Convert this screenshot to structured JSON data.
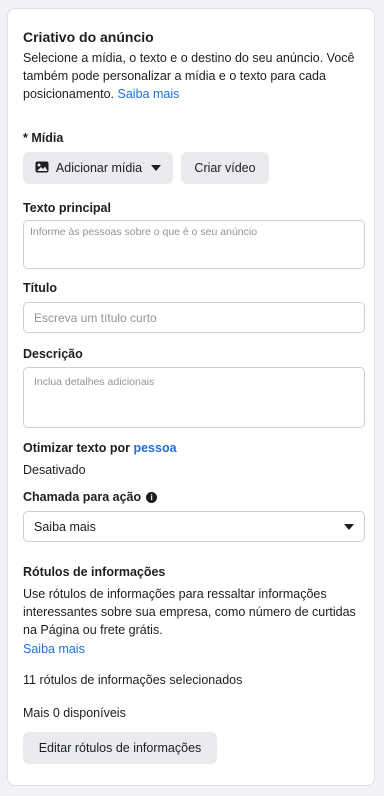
{
  "creative": {
    "title": "Criativo do anúncio",
    "description": "Selecione a mídia, o texto e o destino do seu anúncio. Você também pode personalizar a mídia e o texto para cada posicionamento.",
    "learn_more": "Saiba mais"
  },
  "media": {
    "label": "* Mídia",
    "add_media_button": "Adicionar mídia",
    "create_video_button": "Criar vídeo",
    "image_icon": "image-icon"
  },
  "primary_text": {
    "label": "Texto principal",
    "placeholder": "Informe às pessoas sobre o que é o seu anúncio",
    "value": ""
  },
  "headline": {
    "label": "Título",
    "placeholder": "Escreva um título curto",
    "value": ""
  },
  "description_field": {
    "label": "Descrição",
    "placeholder": "Inclua detalhes adicionais",
    "value": ""
  },
  "optimize": {
    "label": "Otimizar texto por",
    "link": "pessoa",
    "status": "Desativado"
  },
  "cta": {
    "label": "Chamada para ação",
    "info_icon": "info-icon",
    "selected": "Saiba mais"
  },
  "info_labels": {
    "title": "Rótulos de informações",
    "description": "Use rótulos de informações para ressaltar informações interessantes sobre sua empresa, como número de curtidas na Página ou frete grátis.",
    "learn_more": "Saiba mais",
    "selected_count": "11 rótulos de informações selecionados",
    "available": "Mais 0 disponíveis",
    "edit_button": "Editar rótulos de informações"
  },
  "colors": {
    "link": "#216fdb",
    "button_bg": "#e9ebee",
    "border": "#ccd0d5"
  }
}
